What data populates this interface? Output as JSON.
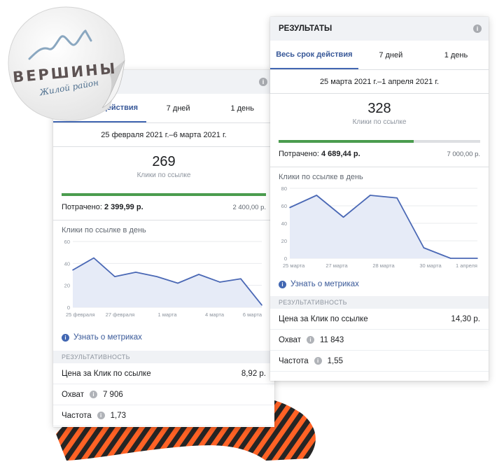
{
  "sticker": {
    "brand_name": "ВЕРШИНЫ",
    "brand_sub": "Жилой район",
    "logo_icon": "mountain-line-icon",
    "colors": {
      "brand": "#5d5353",
      "sub": "#4e6f8e"
    }
  },
  "left_panel": {
    "header_title": "",
    "tabs": [
      {
        "label": "Весь срок действия",
        "active": true
      },
      {
        "label": "7 дней",
        "active": false
      },
      {
        "label": "1 день",
        "active": false
      }
    ],
    "date_range": "25 февраля 2021 г.–6 марта 2021 г.",
    "kpi_value": "269",
    "kpi_label": "Клики по ссылке",
    "budget_progress": 1.0,
    "spent_label": "Потрачено:",
    "spent_value": "2 399,99 р.",
    "budget": "2 400,00 р.",
    "chart_title": "Клики по ссылке в день",
    "learn_more": "Узнать о метриках",
    "section_title": "РЕЗУЛЬТАТИВНОСТЬ",
    "metrics": [
      {
        "label": "Цена за Клик по ссылке",
        "value": "8,92 р.",
        "info": false
      },
      {
        "label": "Охват",
        "value": "7 906",
        "info": true
      },
      {
        "label": "Частота",
        "value": "1,73",
        "info": true
      }
    ]
  },
  "right_panel": {
    "header_title": "РЕЗУЛЬТАТЫ",
    "tabs": [
      {
        "label": "Весь срок действия",
        "active": true
      },
      {
        "label": "7 дней",
        "active": false
      },
      {
        "label": "1 день",
        "active": false
      }
    ],
    "date_range": "25 марта 2021 г.–1 апреля 2021 г.",
    "kpi_value": "328",
    "kpi_label": "Клики по ссылке",
    "budget_progress": 0.67,
    "spent_label": "Потрачено:",
    "spent_value": "4 689,44 р.",
    "budget": "7 000,00 р.",
    "chart_title": "Клики по ссылке в день",
    "learn_more": "Узнать о метриках",
    "section_title": "РЕЗУЛЬТАТИВНОСТЬ",
    "metrics": [
      {
        "label": "Цена за Клик по ссылке",
        "value": "14,30 р.",
        "info": false
      },
      {
        "label": "Охват",
        "value": "11 843",
        "info": true
      },
      {
        "label": "Частота",
        "value": "1,55",
        "info": true
      }
    ]
  },
  "chart_data": [
    {
      "type": "area",
      "title": "Клики по ссылке в день",
      "ylim": [
        0,
        60
      ],
      "yticks": [
        0,
        20,
        40,
        60
      ],
      "xtick_labels": [
        "25 февраля",
        "27 февраля",
        "1 марта",
        "4 марта",
        "6 марта"
      ],
      "x": [
        0,
        1,
        2,
        3,
        4,
        5,
        6,
        7,
        8,
        9
      ],
      "values": [
        34,
        45,
        28,
        32,
        28,
        22,
        30,
        23,
        26,
        2
      ],
      "grid": true,
      "colors": {
        "line": "#4a68b5",
        "fill": "#e6ebf7"
      }
    },
    {
      "type": "area",
      "title": "Клики по ссылке в день",
      "ylim": [
        0,
        80
      ],
      "yticks": [
        0,
        20,
        40,
        60,
        80
      ],
      "xtick_labels": [
        "25 марта",
        "27 марта",
        "28 марта",
        "30 марта",
        "1 апреля"
      ],
      "x": [
        0,
        1,
        2,
        3,
        4,
        5,
        6,
        7
      ],
      "values": [
        58,
        72,
        47,
        72,
        69,
        12,
        0,
        0
      ],
      "grid": true,
      "colors": {
        "line": "#4a68b5",
        "fill": "#e6ebf7"
      }
    }
  ]
}
